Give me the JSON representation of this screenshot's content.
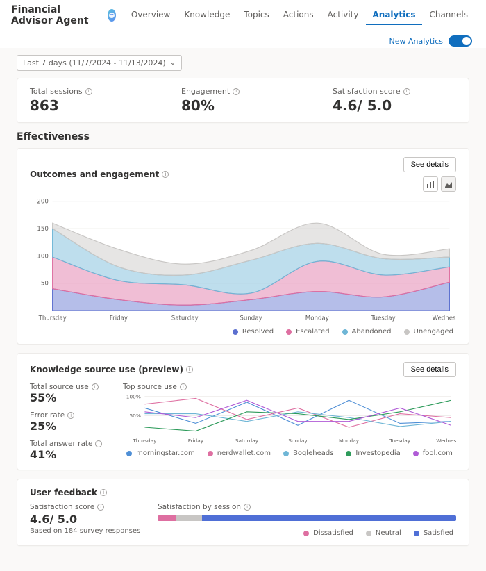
{
  "header": {
    "app_title": "Financial Advisor Agent",
    "tabs": [
      "Overview",
      "Knowledge",
      "Topics",
      "Actions",
      "Activity",
      "Analytics",
      "Channels"
    ],
    "active_tab_index": 5,
    "new_analytics_label": "New Analytics"
  },
  "date_range_label": "Last 7 days (11/7/2024 - 11/13/2024)",
  "kpis": {
    "total_sessions_label": "Total sessions",
    "total_sessions_value": "863",
    "engagement_label": "Engagement",
    "engagement_value": "80%",
    "satisfaction_label": "Satisfaction score",
    "satisfaction_value": "4.6/ 5.0"
  },
  "effectiveness": {
    "section_title": "Effectiveness",
    "outcomes": {
      "title": "Outcomes and engagement",
      "see_details": "See details",
      "legend_resolved": "Resolved",
      "legend_escalated": "Escalated",
      "legend_abandoned": "Abandoned",
      "legend_unengaged": "Unengaged",
      "colors": {
        "resolved": "#5b6fcf",
        "escalated": "#de6fa1",
        "abandoned": "#6fb6d6",
        "unengaged": "#c8c6c4"
      }
    },
    "knowledge": {
      "title": "Knowledge source use (preview)",
      "see_details": "See details",
      "total_source_label": "Total source use",
      "total_source_value": "55%",
      "error_rate_label": "Error rate",
      "error_rate_value": "25%",
      "total_answer_label": "Total answer rate",
      "total_answer_value": "41%",
      "top_source_label": "Top source use",
      "legend": [
        "morningstar.com",
        "nerdwallet.com",
        "Bogleheads",
        "Investopedia",
        "fool.com"
      ],
      "legend_colors": [
        "#4f8fd6",
        "#de6fa1",
        "#6fb6d6",
        "#2e9b5b",
        "#b05bd6"
      ]
    },
    "feedback": {
      "title": "User feedback",
      "satisfaction_label": "Satisfaction score",
      "satisfaction_value": "4.6/ 5.0",
      "based_on": "Based on 184 survey responses",
      "by_session_label": "Satisfaction by session",
      "legend_dissatisfied": "Dissatisfied",
      "legend_neutral": "Neutral",
      "legend_satisfied": "Satisfied",
      "colors": {
        "dissatisfied": "#de6fa1",
        "neutral": "#c8c6c4",
        "satisfied": "#4f6fd6"
      }
    }
  },
  "chart_data": [
    {
      "id": "outcomes_engagement",
      "type": "area",
      "stacked": true,
      "categories": [
        "Thursday",
        "Friday",
        "Saturday",
        "Sunday",
        "Monday",
        "Tuesday",
        "Wednesday"
      ],
      "ylabel": "",
      "ylim": [
        0,
        200
      ],
      "yticks": [
        50,
        100,
        150,
        200
      ],
      "series": [
        {
          "name": "Resolved",
          "color": "#5b6fcf",
          "values": [
            40,
            20,
            10,
            20,
            35,
            25,
            52
          ]
        },
        {
          "name": "Escalated",
          "color": "#de6fa1",
          "values": [
            58,
            35,
            37,
            12,
            55,
            40,
            28
          ]
        },
        {
          "name": "Abandoned",
          "color": "#6fb6d6",
          "values": [
            52,
            25,
            18,
            60,
            33,
            30,
            18
          ]
        },
        {
          "name": "Unengaged",
          "color": "#c8c6c4",
          "values": [
            10,
            32,
            20,
            18,
            37,
            8,
            15
          ]
        }
      ]
    },
    {
      "id": "top_source_use",
      "type": "line",
      "categories": [
        "Thursday",
        "Friday",
        "Saturday",
        "Sunday",
        "Monday",
        "Tuesday",
        "Wednesday"
      ],
      "ylabel": "",
      "ylim": [
        0,
        100
      ],
      "yticks": [
        50,
        100
      ],
      "ytick_labels": [
        "50%",
        "100%"
      ],
      "series": [
        {
          "name": "morningstar.com",
          "color": "#4f8fd6",
          "values": [
            70,
            30,
            85,
            25,
            90,
            30,
            35
          ]
        },
        {
          "name": "nerdwallet.com",
          "color": "#de6fa1",
          "values": [
            80,
            95,
            40,
            70,
            20,
            55,
            45
          ]
        },
        {
          "name": "Bogleheads",
          "color": "#6fb6d6",
          "values": [
            55,
            55,
            35,
            60,
            45,
            22,
            35
          ]
        },
        {
          "name": "Investopedia",
          "color": "#2e9b5b",
          "values": [
            20,
            10,
            60,
            55,
            40,
            60,
            90
          ]
        },
        {
          "name": "fool.com",
          "color": "#b05bd6",
          "values": [
            60,
            45,
            90,
            35,
            35,
            70,
            25
          ]
        }
      ]
    },
    {
      "id": "satisfaction_by_session",
      "type": "bar",
      "orientation": "horizontal-stacked",
      "categories": [
        "Dissatisfied",
        "Neutral",
        "Satisfied"
      ],
      "values": [
        6,
        9,
        85
      ],
      "colors": [
        "#de6fa1",
        "#c8c6c4",
        "#4f6fd6"
      ],
      "unit": "%"
    }
  ]
}
